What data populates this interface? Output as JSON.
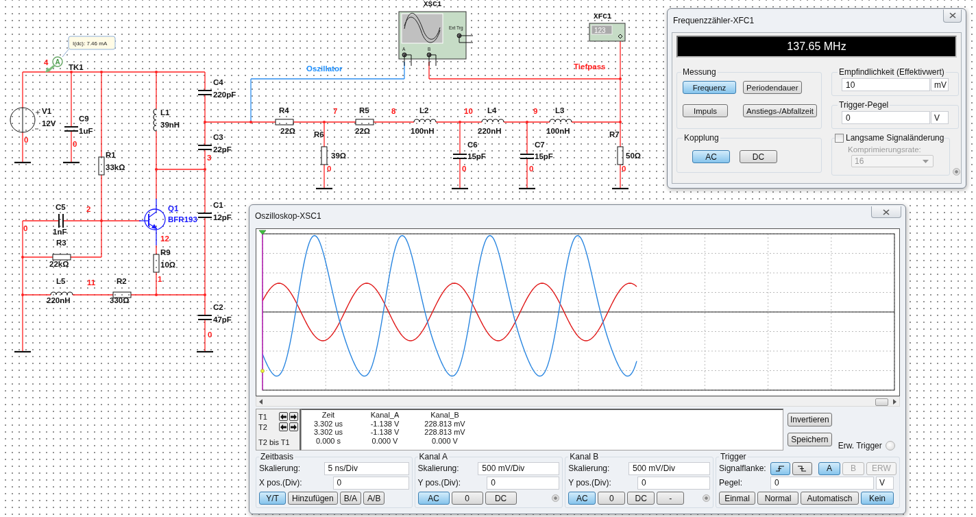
{
  "schematic": {
    "connector": "TK1",
    "probe": {
      "symbol": "A",
      "reading": "I(dc): 7.46 mA"
    },
    "components": [
      {
        "kind": "source",
        "name": "V1",
        "value": "12V"
      },
      {
        "kind": "capacitor",
        "name": "C9",
        "value": "1uF"
      },
      {
        "kind": "inductor",
        "name": "L1",
        "value": "39nH"
      },
      {
        "kind": "capacitor",
        "name": "C4",
        "value": "220pF"
      },
      {
        "kind": "resistor",
        "name": "R4",
        "value": "22Ω"
      },
      {
        "kind": "resistor",
        "name": "R5",
        "value": "22Ω"
      },
      {
        "kind": "inductor",
        "name": "L2",
        "value": "100nH"
      },
      {
        "kind": "inductor",
        "name": "L4",
        "value": "220nH"
      },
      {
        "kind": "inductor",
        "name": "L3",
        "value": "100nH"
      },
      {
        "kind": "resistor",
        "name": "R1",
        "value": "33kΩ"
      },
      {
        "kind": "capacitor",
        "name": "C3",
        "value": "22pF"
      },
      {
        "kind": "resistor",
        "name": "R6",
        "value": "39Ω"
      },
      {
        "kind": "capacitor",
        "name": "C6",
        "value": "15pF"
      },
      {
        "kind": "capacitor",
        "name": "C7",
        "value": "15pF"
      },
      {
        "kind": "resistor",
        "name": "R7",
        "value": "50Ω"
      },
      {
        "kind": "capacitor",
        "name": "C5",
        "value": "1nF"
      },
      {
        "kind": "transistor",
        "name": "Q1",
        "value": "BFR193"
      },
      {
        "kind": "capacitor",
        "name": "C1",
        "value": "12pF"
      },
      {
        "kind": "resistor",
        "name": "R3",
        "value": "22kΩ"
      },
      {
        "kind": "resistor",
        "name": "R9",
        "value": "10Ω"
      },
      {
        "kind": "inductor",
        "name": "L5",
        "value": "220nH"
      },
      {
        "kind": "resistor",
        "name": "R2",
        "value": "330Ω"
      },
      {
        "kind": "capacitor",
        "name": "C2",
        "value": "47pF"
      }
    ],
    "nets": [
      "4",
      "0",
      "0",
      "3",
      "2",
      "0",
      "12",
      "1",
      "11",
      "0",
      "7",
      "8",
      "10",
      "9",
      "0",
      "0",
      "0",
      "0"
    ],
    "wire_labels": [
      {
        "text": "Oszillator",
        "color": "#1e90ff"
      },
      {
        "text": "Tiefpass",
        "color": "#ff1a1a"
      }
    ],
    "instruments": [
      {
        "kind": "oscilloscope",
        "name": "XSC1",
        "terminals": [
          "A",
          "B",
          "Ext Trg"
        ]
      },
      {
        "kind": "counter",
        "name": "XFC1",
        "display": "123"
      }
    ]
  },
  "counter": {
    "title": "Frequenzzähler-XFC1",
    "display": "137.65 MHz",
    "measure": {
      "title": "Messung",
      "options": [
        {
          "label": "Frequenz",
          "selected": true
        },
        {
          "label": "Periodendauer",
          "selected": false
        },
        {
          "label": "Impuls",
          "selected": false
        },
        {
          "label": "Anstiegs-/Abfallzeit",
          "selected": false
        }
      ]
    },
    "coupling": {
      "title": "Kopplung",
      "options": [
        {
          "label": "AC",
          "selected": true
        },
        {
          "label": "DC",
          "selected": false
        }
      ]
    },
    "sensitivity": {
      "title": "Empfindlichkeit (Effektivwert)",
      "value": "10",
      "unit": "mV"
    },
    "trigger_level": {
      "title": "Trigger-Pegel",
      "value": "0",
      "unit": "V"
    },
    "slow_change": {
      "label": "Langsame Signaländerung",
      "checked": false,
      "rate_label": "Komprimierungsrate:",
      "rate_value": "16"
    }
  },
  "oscilloscope": {
    "title": "Oszilloskop-XSC1",
    "cursors": [
      "T1",
      "T2",
      "T2 bis T1"
    ],
    "readout": {
      "columns": [
        "Zeit",
        "Kanal_A",
        "Kanal_B"
      ],
      "rows": [
        [
          "3.302 us",
          "-1.138 V",
          "228.813 mV"
        ],
        [
          "3.302 us",
          "-1.138 V",
          "228.813 mV"
        ],
        [
          "0.000 s",
          "0.000 V",
          "0.000 V"
        ]
      ]
    },
    "side_buttons": [
      "Invertieren",
      "Speichern"
    ],
    "ext_trigger": {
      "label": "Erw. Trigger",
      "on": false
    },
    "timebase": {
      "title": "Zeitbasis",
      "fields": [
        {
          "label": "Skalierung:",
          "value": "5 ns/Div"
        },
        {
          "label": "X pos.(Div):",
          "value": "0"
        }
      ],
      "modes": [
        {
          "label": "Y/T",
          "selected": true
        },
        {
          "label": "Hinzufügen",
          "selected": false
        },
        {
          "label": "B/A",
          "selected": false
        },
        {
          "label": "A/B",
          "selected": false
        }
      ]
    },
    "channels": [
      {
        "title": "Kanal A",
        "fields": [
          {
            "label": "Skalierung:",
            "value": "500 mV/Div"
          },
          {
            "label": "Y pos.(Div):",
            "value": "0"
          }
        ],
        "coupling": [
          {
            "label": "AC",
            "selected": true
          },
          {
            "label": "0",
            "selected": false
          },
          {
            "label": "DC",
            "selected": false
          }
        ]
      },
      {
        "title": "Kanal B",
        "fields": [
          {
            "label": "Skalierung:",
            "value": "500 mV/Div"
          },
          {
            "label": "Y pos.(Div):",
            "value": "0"
          }
        ],
        "coupling": [
          {
            "label": "AC",
            "selected": true
          },
          {
            "label": "0",
            "selected": false
          },
          {
            "label": "DC",
            "selected": false
          },
          {
            "label": "-",
            "selected": false
          }
        ]
      }
    ],
    "trigger": {
      "title": "Trigger",
      "edge_label": "Signalflanke:",
      "edges": [
        {
          "kind": "rising",
          "selected": true
        },
        {
          "kind": "falling",
          "selected": false
        }
      ],
      "sources": [
        {
          "label": "A",
          "selected": true,
          "disabled": false
        },
        {
          "label": "B",
          "selected": false,
          "disabled": true
        },
        {
          "label": "ERW",
          "selected": false,
          "disabled": true
        }
      ],
      "level": {
        "label": "Pegel:",
        "value": "0",
        "unit": "V"
      },
      "modes": [
        {
          "label": "Einmal",
          "selected": false
        },
        {
          "label": "Normal",
          "selected": false
        },
        {
          "label": "Automatisch",
          "selected": false
        },
        {
          "label": "Kein",
          "selected": true
        }
      ]
    }
  }
}
